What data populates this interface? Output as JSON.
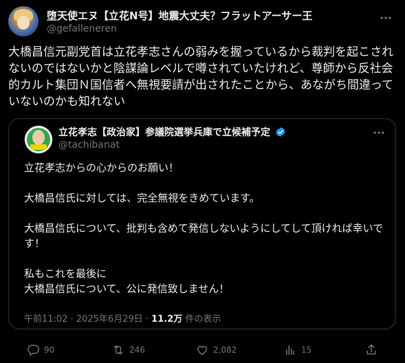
{
  "post": {
    "author_name": "堕天使エヌ【立花N号】地震大丈夫？フラットアーサー王",
    "author_handle": "@gefalleneren",
    "text": "大橋昌信元副党首は立花孝志さんの弱みを握っているから裁判を起こされないのではないかと陰謀論レベルで噂されていたけれど、尊師から反社会的カルト集団Ｎ国信者へ無視要請が出されたことから、あながち間違っていないのかも知れない",
    "actions": {
      "replies": "90",
      "retweets": "246",
      "likes": "2,082",
      "views": "15"
    }
  },
  "quote": {
    "author_name": "立花孝志【政治家】参議院選挙兵庫で立候補予定",
    "author_handle": "@tachibanat",
    "paragraphs": [
      "立花孝志からの心からのお願い！",
      "大橋昌信氏に対しては、完全無視をきめています。",
      "大橋昌信氏について、批判も含めて発信しないようにしてして頂ければ幸いです！",
      "私もこれを最後に\n大橋昌信氏について、公に発信致しません！"
    ],
    "timestamp": "午前11:02 · 2025年6月29日 ·",
    "views_count": "11.2万",
    "views_label": "件の表示"
  },
  "icons": {
    "more": "more-horizontal-icon",
    "verified": "verified-badge-icon",
    "reply": "reply-icon",
    "retweet": "retweet-icon",
    "like": "heart-icon",
    "views": "bar-chart-icon",
    "share": "share-icon"
  },
  "colors": {
    "background": "#000000",
    "text": "#e7e9ea",
    "muted": "#71767b",
    "border": "#2f3336",
    "verified": "#1d9bf0"
  }
}
